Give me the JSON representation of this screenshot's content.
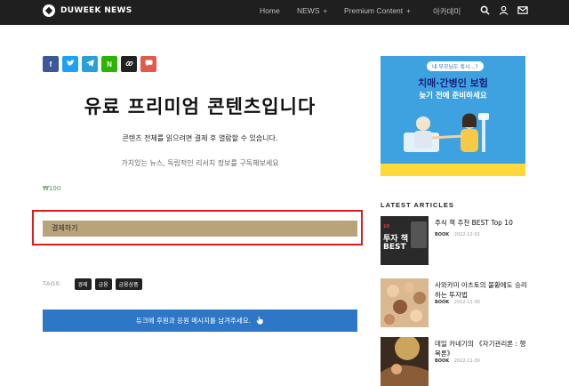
{
  "header": {
    "logo_text": "DUWEEK NEWS",
    "nav": [
      {
        "label": "Home",
        "has_plus": false
      },
      {
        "label": "NEWS",
        "has_plus": true
      },
      {
        "label": "Premium Content",
        "has_plus": true
      },
      {
        "label": "아카데미",
        "has_plus": false
      }
    ],
    "plus_symbol": "+",
    "icons": [
      "search-icon",
      "user-icon",
      "mail-icon"
    ]
  },
  "share_buttons": [
    {
      "name": "facebook",
      "glyph": "f",
      "color": "#3b5998"
    },
    {
      "name": "twitter",
      "glyph": "t",
      "color": "#1da1f2"
    },
    {
      "name": "telegram",
      "glyph": "➤",
      "color": "#2a9fd6"
    },
    {
      "name": "naver",
      "glyph": "N",
      "color": "#2db400"
    },
    {
      "name": "copy-link",
      "glyph": "🔗",
      "color": "#222222"
    },
    {
      "name": "comment",
      "glyph": "●",
      "color": "#e05b4b"
    }
  ],
  "main": {
    "headline": "유료 프리미엄 콘텐츠입니다",
    "desc1": "콘텐츠 전체를 읽으려면 결제 후 열람할 수 있습니다.",
    "desc2": "가치있는 뉴스, 독립적인 리서치 정보를 구독해보세요",
    "price": "₩100",
    "pay_button": "결제하기",
    "tags_label": "TAGS:",
    "tags": [
      "경제",
      "금융",
      "금융상품"
    ],
    "donate_text": "듀크에 후원과 응원 메시지를 남겨주세요."
  },
  "ad": {
    "bubble": "내 부모님도 혹시…?",
    "title": "치매·간병인 보험",
    "subtitle": "늦기 전에 준비하세요",
    "bottom": "",
    "colors": {
      "background": "#3ea2e0",
      "title": "#1a237e",
      "bottom": "#ffd83a"
    }
  },
  "sidebar": {
    "latest_heading": "LATEST ARTICLES",
    "articles": [
      {
        "title": "주식 책 추천 BEST Top 10",
        "category": "BOOK",
        "date": "2022-12-02",
        "thumb_line1": "10",
        "thumb_line2": "투자 책",
        "thumb_line3": "BEST"
      },
      {
        "title": "사와카미 아츠토의 불황에도 승리하는 투자법",
        "category": "BOOK",
        "date": "2022-11-30"
      },
      {
        "title": "데일 카네기의 《자기관리론 : 행복론》",
        "category": "BOOK",
        "date": "2022-11-30"
      }
    ]
  }
}
